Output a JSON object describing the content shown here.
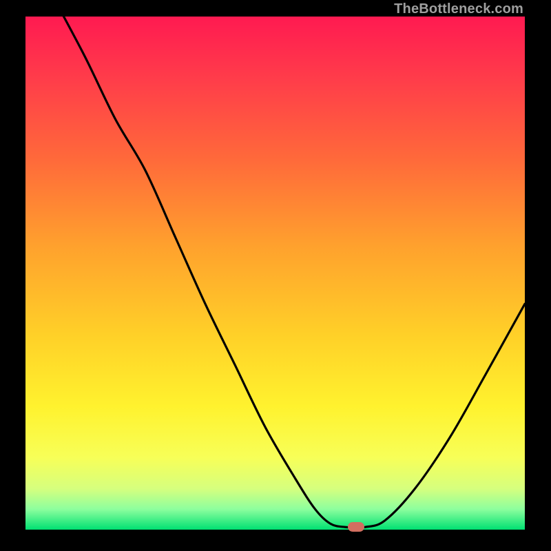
{
  "watermark": {
    "text": "TheBottleneck.com"
  },
  "marker": {
    "x_pct": 66.2,
    "y_pct": 99.5
  },
  "chart_data": {
    "type": "line",
    "title": "",
    "xlabel": "",
    "ylabel": "",
    "xlim": [
      0,
      100
    ],
    "ylim": [
      0,
      100
    ],
    "grid": false,
    "legend": false,
    "background_gradient": [
      "#ff1a51",
      "#ff3c4a",
      "#ff6a3a",
      "#ffa22d",
      "#ffd028",
      "#fff22e",
      "#f7ff58",
      "#d6ff7e",
      "#8dff9e",
      "#00e072"
    ],
    "annotations": [
      {
        "type": "marker",
        "shape": "rounded-rect",
        "x": 66.2,
        "y": 0.5,
        "color": "#d26f60"
      }
    ],
    "series": [
      {
        "name": "bottleneck-curve",
        "x": [
          6.0,
          12.0,
          18.0,
          24.0,
          30.0,
          36.0,
          42.0,
          48.0,
          54.0,
          58.0,
          61.0,
          64.0,
          68.0,
          72.0,
          78.0,
          85.0,
          92.0,
          100.0
        ],
        "y": [
          103.0,
          92.0,
          80.0,
          70.0,
          57.0,
          44.0,
          32.0,
          20.0,
          10.0,
          4.0,
          1.2,
          0.5,
          0.5,
          1.8,
          8.0,
          18.0,
          30.0,
          44.0
        ]
      }
    ]
  }
}
